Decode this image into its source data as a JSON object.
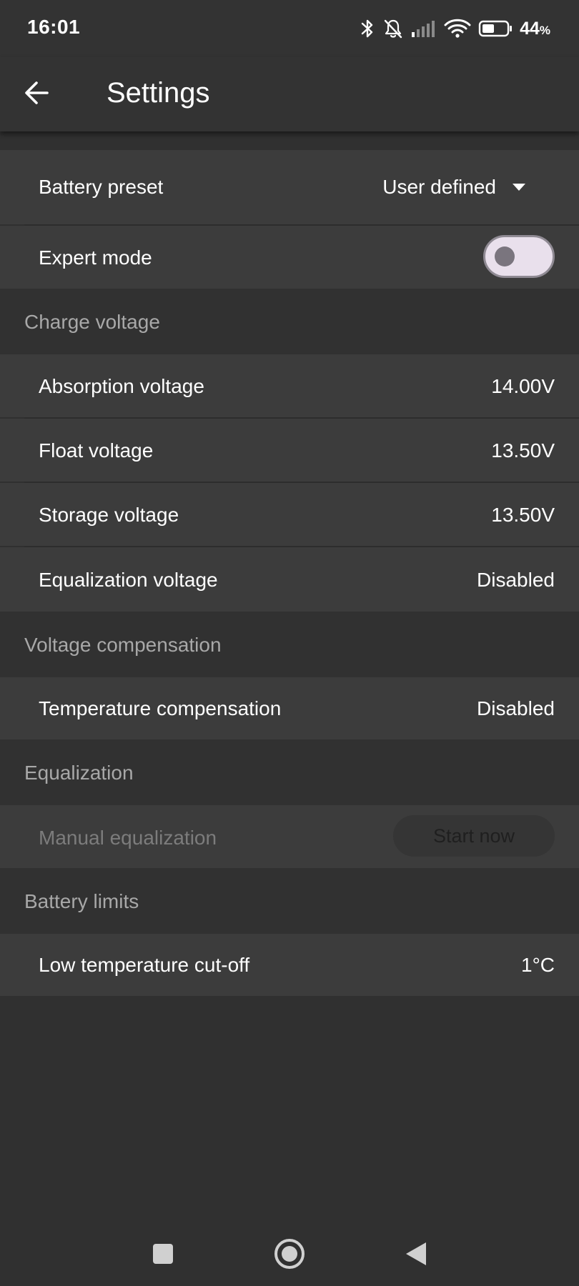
{
  "status_bar": {
    "time": "16:01",
    "icons": [
      "bluetooth-icon",
      "bell-off-icon",
      "cellular-signal-icon",
      "wifi-icon",
      "battery-icon"
    ],
    "battery_percent": "44",
    "battery_percent_sign": "%"
  },
  "app_bar": {
    "back_icon": "arrow-left-icon",
    "title": "Settings"
  },
  "battery_preset": {
    "label": "Battery preset",
    "value": "User defined",
    "icon": "dropdown-arrow-icon"
  },
  "expert_mode": {
    "label": "Expert mode",
    "enabled": false
  },
  "charge_voltage": {
    "header": "Charge voltage",
    "items": [
      {
        "label": "Absorption voltage",
        "value": "14.00V"
      },
      {
        "label": "Float voltage",
        "value": "13.50V"
      },
      {
        "label": "Storage voltage",
        "value": "13.50V"
      },
      {
        "label": "Equalization voltage",
        "value": "Disabled"
      }
    ]
  },
  "voltage_compensation": {
    "header": "Voltage compensation",
    "items": [
      {
        "label": "Temperature compensation",
        "value": "Disabled"
      }
    ]
  },
  "equalization": {
    "header": "Equalization",
    "manual_label": "Manual equalization",
    "button_label": "Start now"
  },
  "battery_limits": {
    "header": "Battery limits",
    "items": [
      {
        "label": "Low temperature cut-off",
        "value": "1°C"
      }
    ]
  },
  "nav_bar": {
    "icons": [
      "square-recents-icon",
      "circle-home-icon",
      "triangle-back-icon"
    ]
  },
  "colors": {
    "background": "#303030",
    "row_background": "#3c3c3c",
    "section_text": "#a8a8a8",
    "toggle_track": "#e9e0ec",
    "toggle_knob": "#7a757e"
  }
}
